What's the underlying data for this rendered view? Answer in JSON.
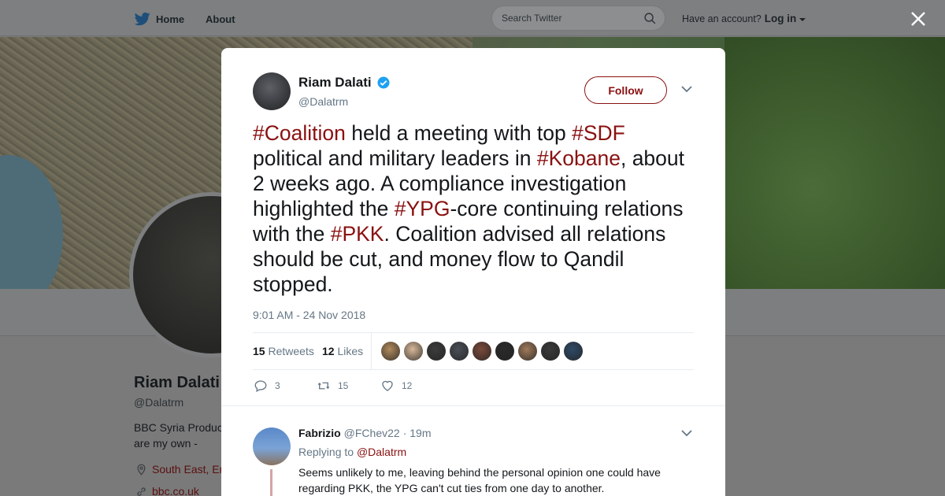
{
  "nav": {
    "home_label": "Home",
    "about_label": "About",
    "search_placeholder": "Search Twitter",
    "account_prompt": "Have an account?",
    "login_label": "Log in"
  },
  "background_profile": {
    "name": "Riam Dalati",
    "handle": "@Dalatrm",
    "bio_line1": "BBC Syria Produc",
    "bio_line2": "are my own -",
    "location": "South East, En",
    "link": "bbc.co.uk"
  },
  "tweet": {
    "author_name": "Riam Dalati",
    "author_handle": "@Dalatrm",
    "follow_label": "Follow",
    "text_parts": [
      {
        "t": "#Coalition",
        "tag": true
      },
      {
        "t": " held a meeting with top ",
        "tag": false
      },
      {
        "t": "#SDF",
        "tag": true
      },
      {
        "t": " political and military leaders in ",
        "tag": false
      },
      {
        "t": "#Kobane",
        "tag": true
      },
      {
        "t": ", about 2 weeks ago. A compliance investigation highlighted the ",
        "tag": false
      },
      {
        "t": "#YPG",
        "tag": true
      },
      {
        "t": "-core continuing relations with the ",
        "tag": false
      },
      {
        "t": "#PKK",
        "tag": true
      },
      {
        "t": ". Coalition advised all relations should be cut, and money flow to Qandil stopped.",
        "tag": false
      }
    ],
    "timestamp": "9:01 AM - 24 Nov 2018",
    "retweets_count": "15",
    "retweets_label": "Retweets",
    "likes_count": "12",
    "likes_label": "Likes",
    "liker_colors": [
      "#b08a5c",
      "#d8b89a",
      "#3c3c3c",
      "#4a4f57",
      "#7a4a3a",
      "#2a2a2a",
      "#a07a5a",
      "#3a3a3a",
      "#2f4a66"
    ],
    "actions": {
      "reply_count": "3",
      "retweet_count": "15",
      "like_count": "12"
    }
  },
  "reply": {
    "name": "Fabrizio",
    "handle": "@FChev22",
    "time": "· 19m",
    "replying_to_label": "Replying to",
    "replying_to_handle": "@Dalatrm",
    "text": "Seems unlikely to me, leaving behind the personal opinion one could have regarding PKK, the YPG can't cut ties from one day to another."
  },
  "colors": {
    "accent": "#8a1111",
    "muted": "#657786",
    "verified": "#1da1f2"
  }
}
